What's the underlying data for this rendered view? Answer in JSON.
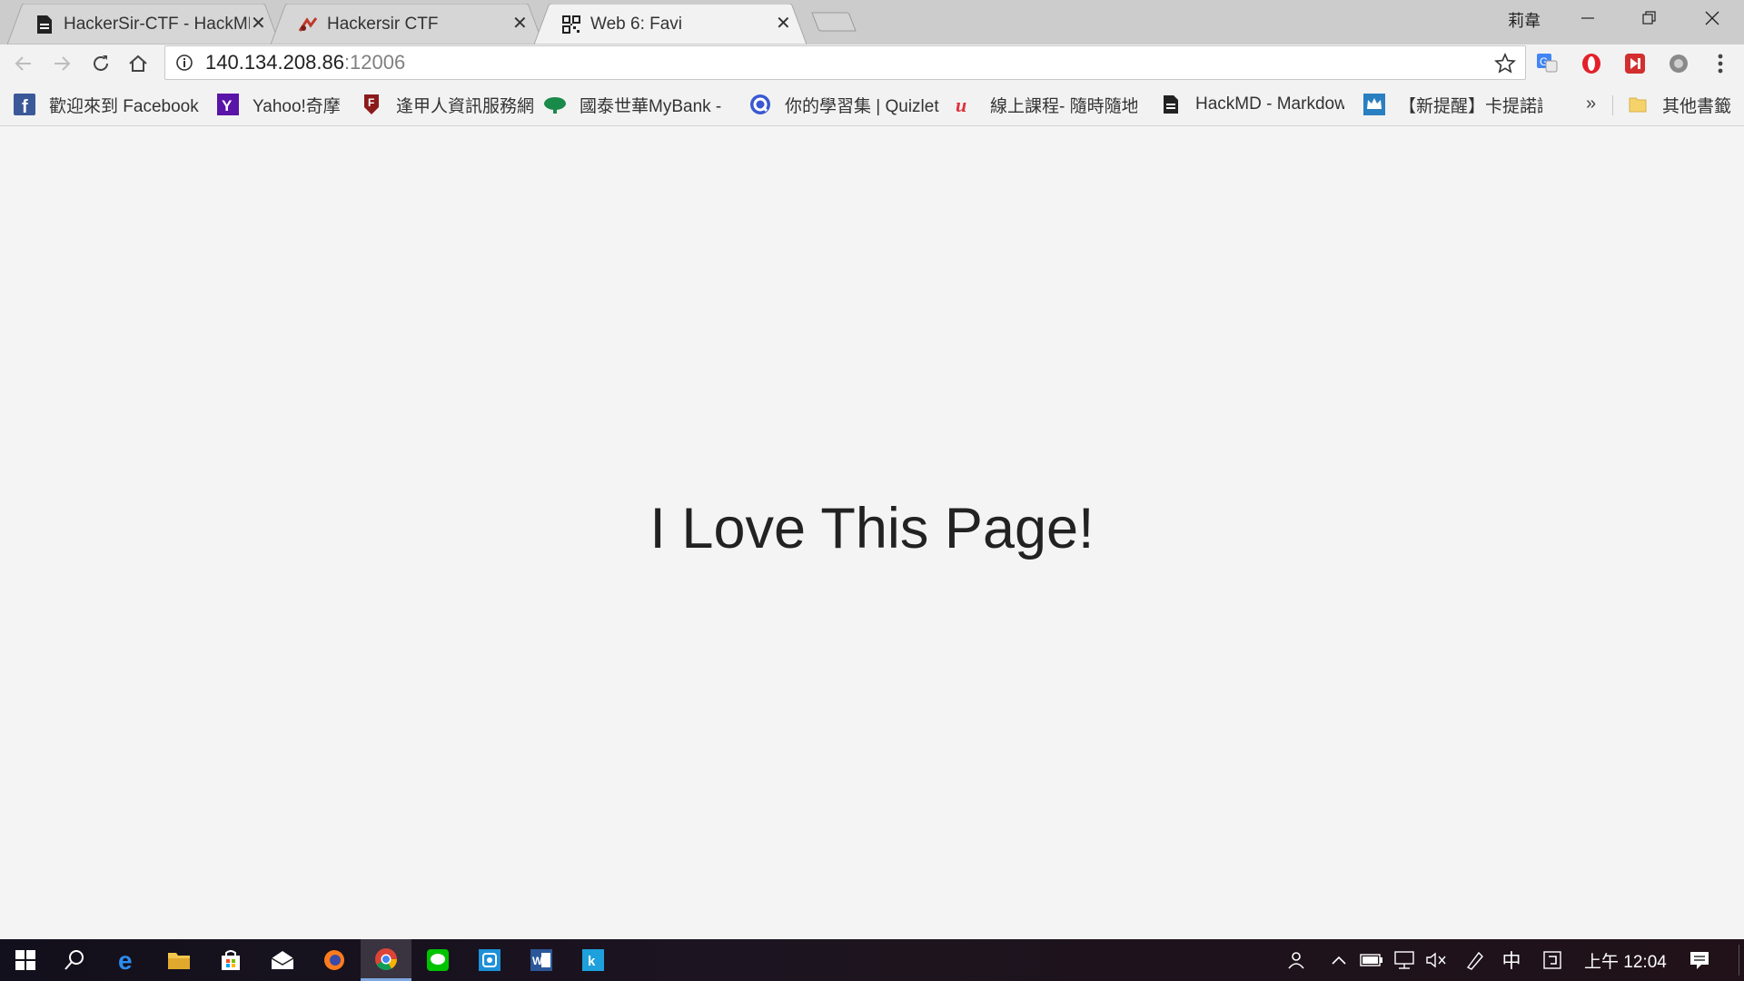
{
  "window": {
    "user": "莉韋",
    "tabs": [
      {
        "title": "HackerSir-CTF - HackMD",
        "icon": "document-icon"
      },
      {
        "title": "Hackersir CTF",
        "icon": "hackersir-logo-icon"
      },
      {
        "title": "Web 6: Favi",
        "icon": "qr-icon",
        "active": true
      }
    ]
  },
  "toolbar": {
    "url_host": "140.134.208.86",
    "url_port": ":12006"
  },
  "bookmarks": [
    {
      "label": "歡迎來到 Facebook",
      "icon": "facebook-icon"
    },
    {
      "label": "Yahoo!奇摩",
      "icon": "yahoo-icon"
    },
    {
      "label": "逢甲人資訊服務網",
      "icon": "fcu-icon"
    },
    {
      "label": "國泰世華MyBank - I",
      "icon": "cathay-tree-icon"
    },
    {
      "label": "你的學習集 | Quizlet",
      "icon": "quizlet-icon"
    },
    {
      "label": "線上課程- 隨時隨地",
      "icon": "udemy-icon"
    },
    {
      "label": "HackMD - Markdow",
      "icon": "document-icon"
    },
    {
      "label": "【新提醒】卡提諾論",
      "icon": "crown-icon"
    }
  ],
  "bookmarks_more": "»",
  "bookmarks_other": "其他書籤",
  "page": {
    "heading": "I Love This Page!"
  },
  "taskbar": {
    "ime": "中",
    "time": "上午 12:04"
  },
  "colors": {
    "tabstrip": "#cccccc",
    "toolbar": "#f2f2f2",
    "page_bg": "#f4f4f4",
    "taskbar": "#1a1420"
  }
}
